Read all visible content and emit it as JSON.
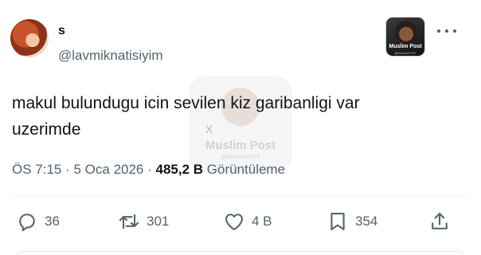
{
  "author": {
    "display_name": "s",
    "handle": "@lavmiknatisiyim"
  },
  "corner_watermark": {
    "title": "Muslim Post",
    "subtitle": "@MuslimPOST"
  },
  "tweet": {
    "text_line1": "makul bulundugu icin sevilen kiz garibanligi var",
    "text_line2": "uzerimde"
  },
  "center_watermark": {
    "mark": "X",
    "title": "Muslim Post",
    "subtitle": "@MuslimPOST"
  },
  "meta": {
    "time": "ÖS 7:15",
    "sep1": " · ",
    "date": "5 Oca 2026",
    "sep2": " · ",
    "views_count": "485,2 B",
    "views_label": " Görüntüleme"
  },
  "actions": {
    "replies": "36",
    "reposts": "301",
    "likes": "4 B",
    "bookmarks": "354"
  },
  "icons": [
    "reply-icon",
    "repost-icon",
    "like-icon",
    "bookmark-icon",
    "share-icon",
    "more-icon"
  ]
}
